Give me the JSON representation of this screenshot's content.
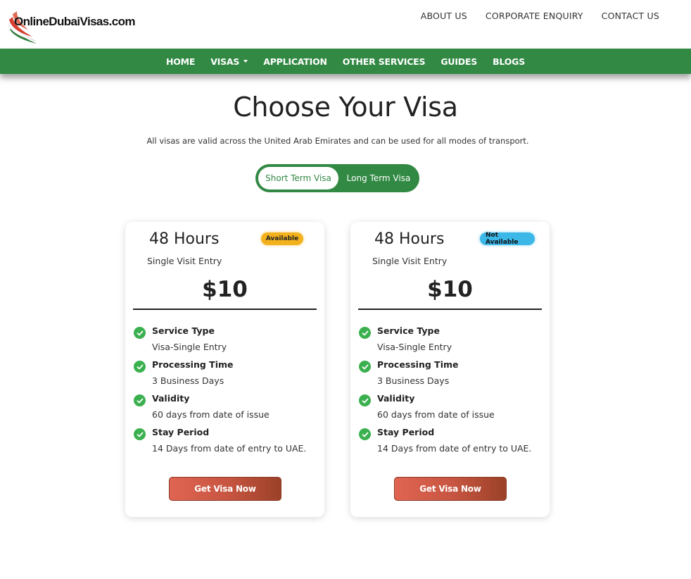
{
  "brand": {
    "logo_text": "OnlineDubaiVisas.com"
  },
  "top_links": [
    "ABOUT US",
    "CORPORATE ENQUIRY",
    "CONTACT US"
  ],
  "nav": {
    "items": [
      {
        "label": "HOME"
      },
      {
        "label": "VISAS"
      },
      {
        "label": "APPLICATION"
      },
      {
        "label": "OTHER SERVICES"
      },
      {
        "label": "GUIDES"
      },
      {
        "label": "BLOGS"
      }
    ],
    "color": "#328944"
  },
  "page": {
    "title": "Choose Your Visa",
    "subtitle": "All visas are valid across the United Arab Emirates and can be used for all modes of transport."
  },
  "toggle": {
    "short_label": "Short Term Visa",
    "long_label": "Long Term Visa",
    "selected": "Short Term Visa"
  },
  "cards": [
    {
      "duration": "48 Hours",
      "badge": "Available",
      "badge_color": "#f3b21d",
      "entry": "Single Visit Entry",
      "price": "$10",
      "features": [
        {
          "label": "Service Type",
          "value": "Visa-Single Entry"
        },
        {
          "label": "Processing Time",
          "value": "3 Business Days"
        },
        {
          "label": "Validity",
          "value": "60 days from date of issue"
        },
        {
          "label": "Stay Period",
          "value": "14 Days from date of entry to UAE."
        }
      ],
      "button": "Get Visa Now"
    },
    {
      "duration": "48 Hours",
      "badge": "Not Available",
      "badge_color": "#3bb7e8",
      "entry": "Single Visit Entry",
      "price": "$10",
      "features": [
        {
          "label": "Service Type",
          "value": "Visa-Single Entry"
        },
        {
          "label": "Processing Time",
          "value": "3 Business Days"
        },
        {
          "label": "Validity",
          "value": "60 days from date of issue"
        },
        {
          "label": "Stay Period",
          "value": "14 Days from date of entry to UAE."
        }
      ],
      "button": "Get Visa Now"
    }
  ],
  "icons": {
    "feature_check": "check-circle-icon",
    "dropdown": "caret-down-icon"
  }
}
